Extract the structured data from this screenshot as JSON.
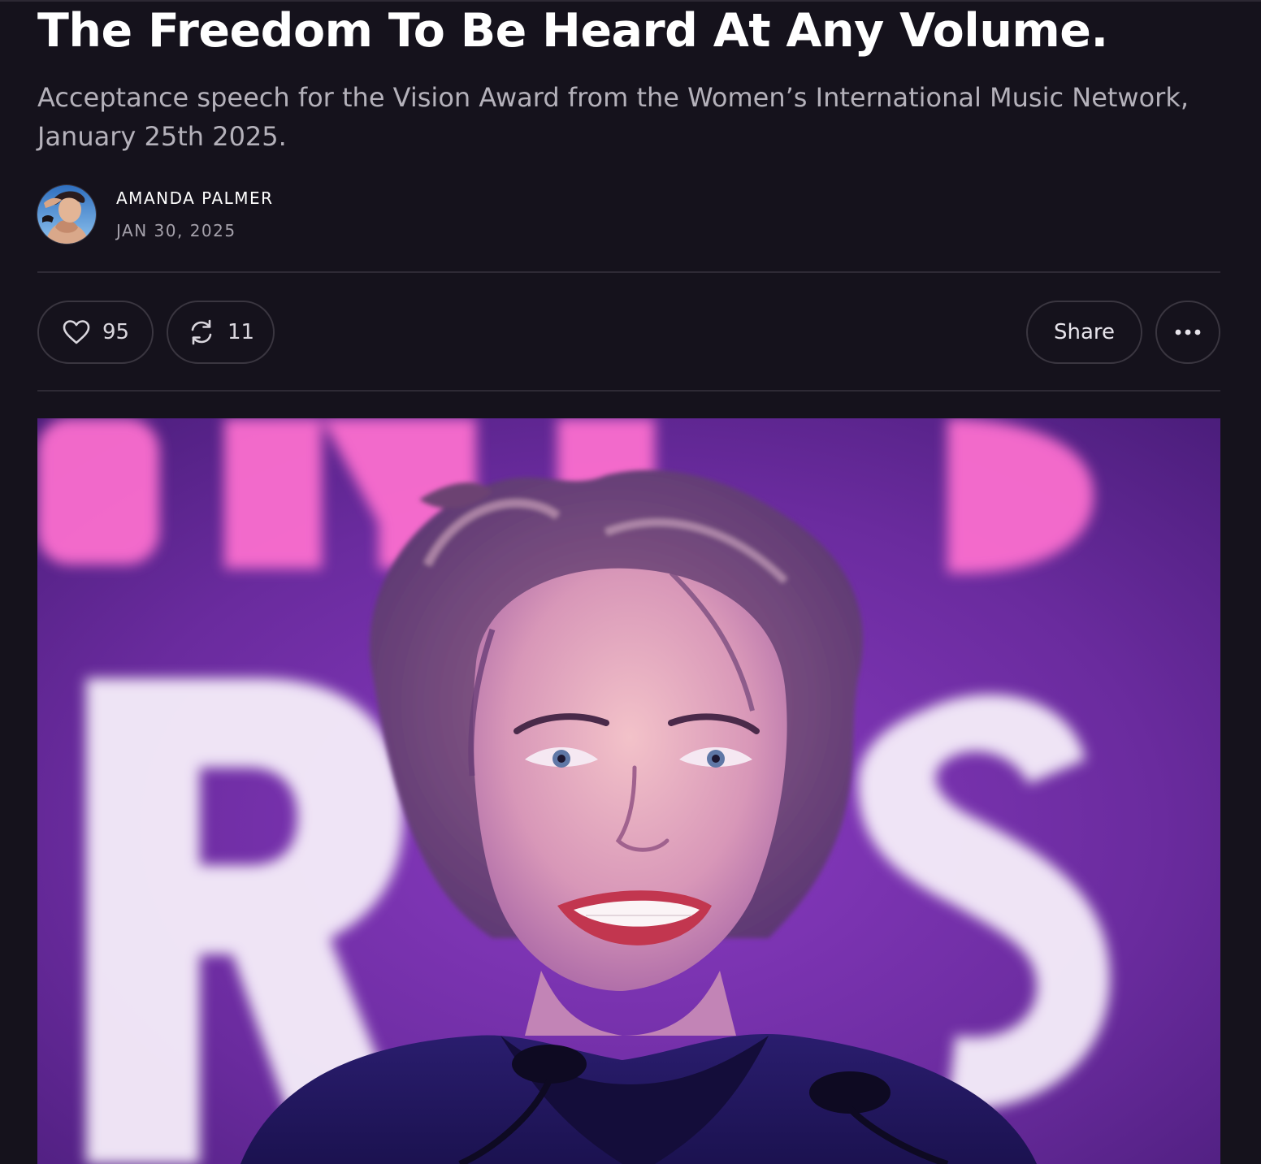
{
  "post": {
    "title": "The Freedom To Be Heard At Any Volume.",
    "subtitle": "Acceptance speech for the Vision Award from the Women’s International Music Network, January 25th 2025.",
    "author": {
      "name": "AMANDA PALMER",
      "avatar_icon": "author-avatar"
    },
    "date": "JAN 30, 2025"
  },
  "actions": {
    "like_count": "95",
    "restack_count": "11",
    "share_label": "Share",
    "like_icon": "heart-icon",
    "restack_icon": "restack-icon",
    "more_icon": "ellipsis-icon"
  },
  "hero_image": {
    "description_icon": "hero-photo",
    "backdrop_letters_top": "ONS",
    "backdrop_letters_bottom": "RIES"
  },
  "colors": {
    "background": "#15121c",
    "title_text": "#ffffff",
    "subtitle_text": "#b4b1ba",
    "pill_border": "#3a3640",
    "divider": "#2e2a35",
    "photo_purple": "#6a2b9e",
    "photo_pink": "#ff6fd0"
  }
}
